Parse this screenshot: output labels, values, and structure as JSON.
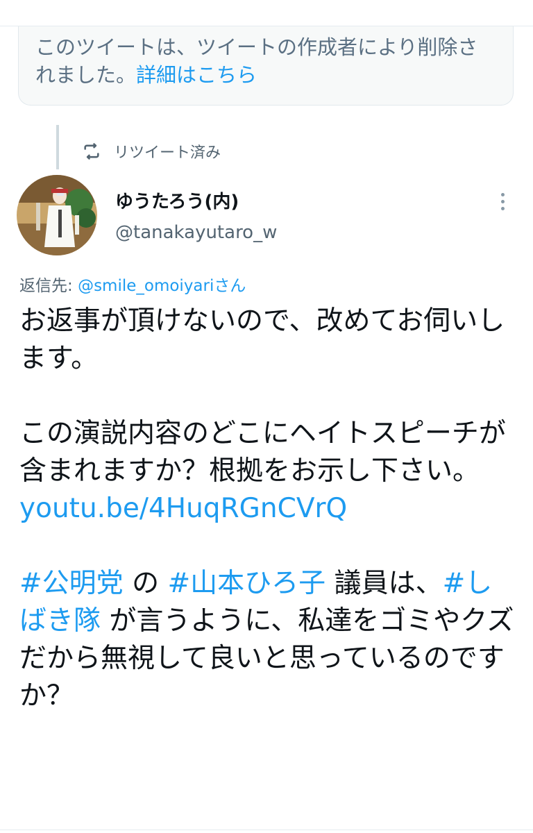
{
  "deleted_notice": {
    "text": "このツイートは、ツイートの作成者により削除されました。",
    "link": "詳細はこちら"
  },
  "retweet": {
    "label": "リツイート済み"
  },
  "author": {
    "display_name": "ゆうたろう(内)",
    "handle": "@tanakayutaro_w"
  },
  "reply": {
    "prefix": "返信先: ",
    "mention": "@smile_omoiyari",
    "suffix": "さん"
  },
  "tweet": {
    "p1": "お返事が頂けないので、改めてお伺いします。",
    "p2": "この演説内容のどこにヘイトスピーチが含まれますか？根拠をお示し下さい。",
    "link": "youtu.be/4HuqRGnCVrQ",
    "hashtag1": "#公明党",
    "text1": " の ",
    "hashtag2": "#山本ひろ子",
    "text2": " 議員は、",
    "hashtag3": "#しばき隊",
    "text3": " が言うように、私達をゴミやクズだから無視して良いと思っているのですか？"
  },
  "colors": {
    "accent": "#1d9bf0",
    "secondary_text": "#536471",
    "card_bg": "#f7f9f9"
  },
  "icons": {
    "retweet": "retweet-icon",
    "more": "more-vertical-icon"
  }
}
